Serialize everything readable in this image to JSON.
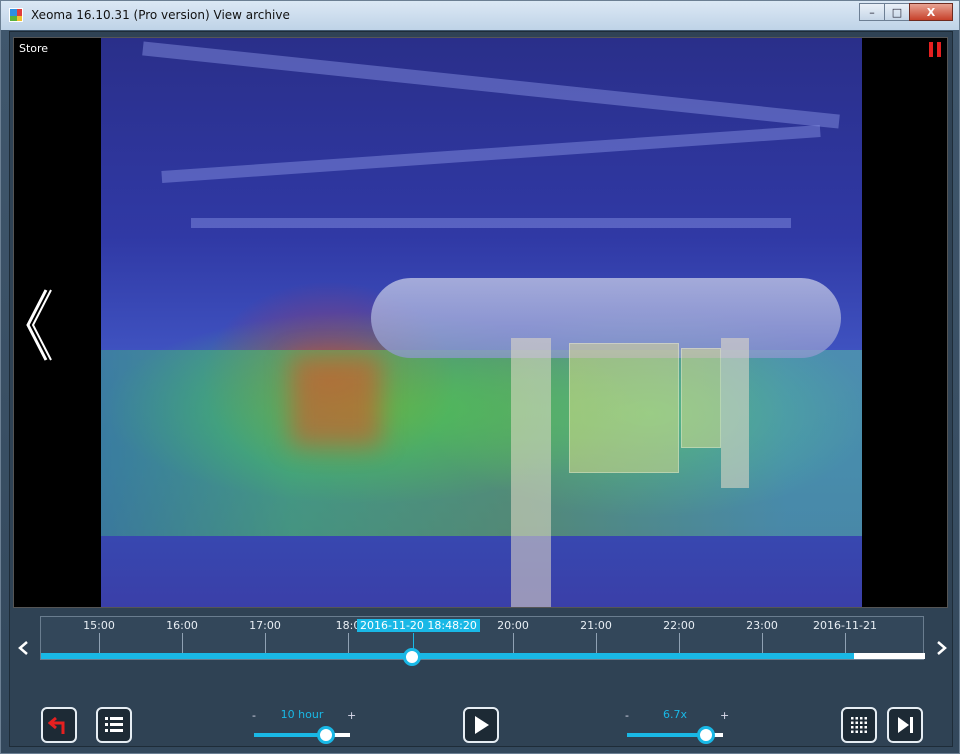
{
  "window": {
    "title": "Xeoma 16.10.31 (Pro version) View archive",
    "minimize": "–",
    "restore": "□",
    "close": "X"
  },
  "camera": {
    "label": "Store",
    "status_icon": "pause-icon"
  },
  "timeline": {
    "ticks": [
      "15:00",
      "16:00",
      "17:00",
      "18:0",
      "20:00",
      "21:00",
      "22:00",
      "23:00",
      "2016-11-21"
    ],
    "cursor_label": "2016-11-20 18:48:20",
    "position_fraction": 0.42,
    "filled_fraction": 0.92,
    "prev_icon": "chevron-left-icon",
    "next_icon": "chevron-right-icon"
  },
  "controls": {
    "scale": {
      "minus": "-",
      "plus": "+",
      "value": "10 hour",
      "level_fraction": 0.75
    },
    "speed": {
      "minus": "-",
      "plus": "+",
      "value": "6.7x",
      "level_fraction": 0.82
    },
    "icons": {
      "back": "back-arrow-icon",
      "list": "list-icon",
      "play": "play-icon",
      "grid": "grid-icon",
      "skip": "skip-end-icon"
    }
  },
  "colors": {
    "accent": "#19b8e6",
    "record": "#e52020"
  }
}
